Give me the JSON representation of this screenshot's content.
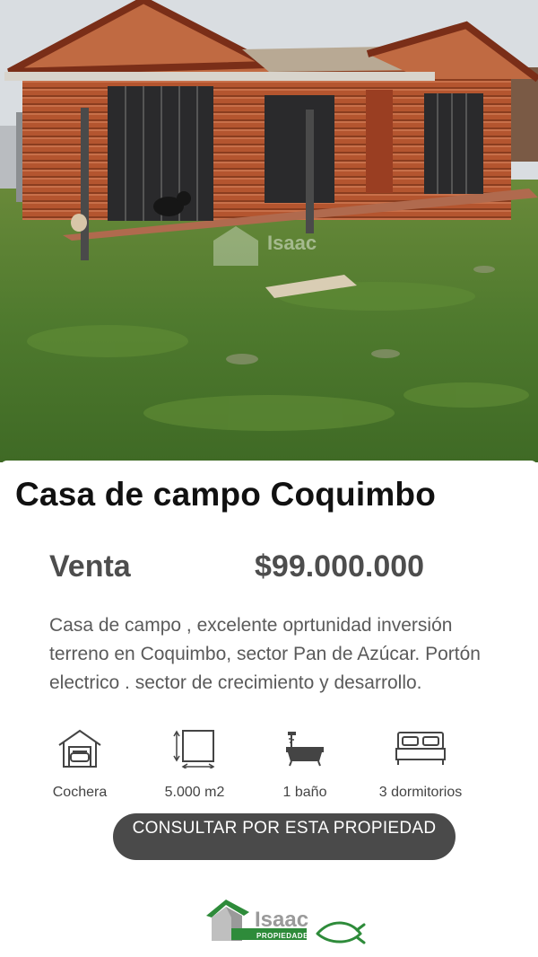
{
  "listing": {
    "title": "Casa de campo Coquimbo",
    "operation": "Venta",
    "price": "$99.000.000",
    "description": "Casa de campo , excelente oprtunidad inversión terreno en Coquimbo, sector Pan de Azúcar. Portón electrico . sector de crecimiento y desarrollo."
  },
  "features": [
    {
      "icon": "garage-icon",
      "label": "Cochera"
    },
    {
      "icon": "area-icon",
      "label": "5.000 m2"
    },
    {
      "icon": "bathtub-icon",
      "label": "1 baño"
    },
    {
      "icon": "bed-icon",
      "label": "3 dormitorios"
    }
  ],
  "cta": {
    "label": "CONSULTAR POR ESTA PROPIEDAD"
  },
  "brand": {
    "name": "Isaac",
    "tagline": "PROPIEDADES",
    "logo_icon": "house-logo-icon",
    "symbol_icon": "fish-icon",
    "color": "#2e8b3a"
  },
  "colors": {
    "text_dark": "#111111",
    "text_gray": "#4d4d4d",
    "button_bg": "#4a4a4a",
    "wood": "#b85a36",
    "grass": "#4f7a2e"
  }
}
